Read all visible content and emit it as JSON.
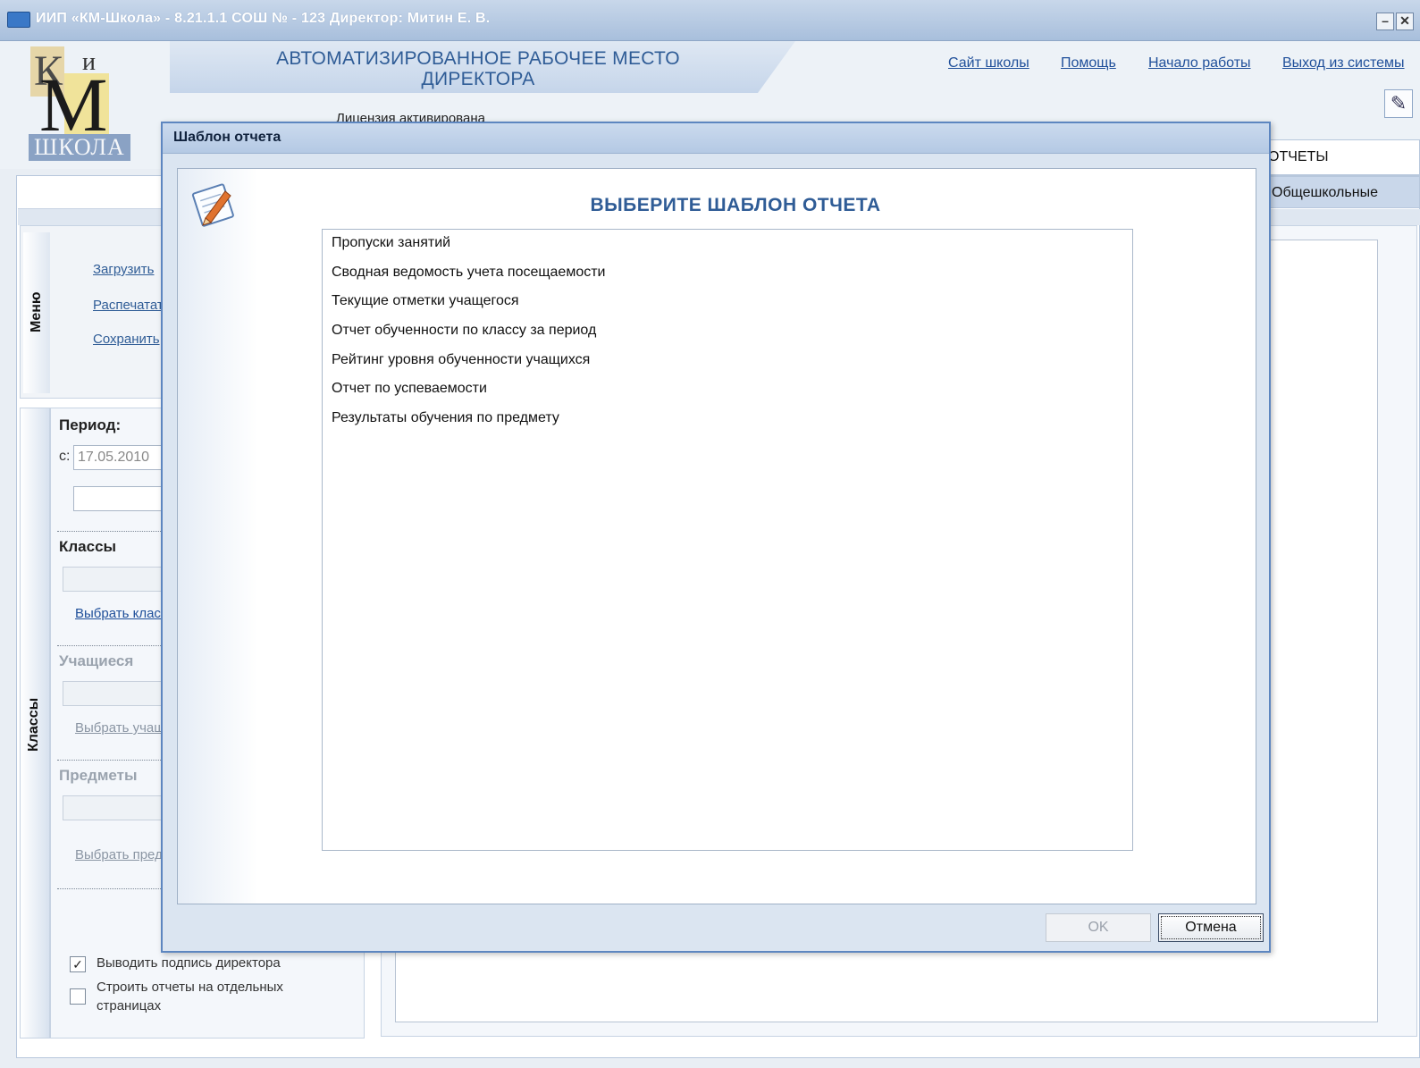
{
  "window": {
    "title": "ИИП «КМ-Школа» - 8.21.1.1 СОШ № - 123 Директор: Митин Е. В.",
    "minimize": "–",
    "close": "✕"
  },
  "logo": {
    "k": "К",
    "i": "и",
    "m": "М",
    "school": "ШКОЛА"
  },
  "header": {
    "banner": "АВТОМАТИЗИРОВАННОЕ РАБОЧЕЕ МЕСТО ДИРЕКТОРА",
    "license": "Лицензия активирована",
    "links": [
      "Сайт школы",
      "Помощь",
      "Начало работы",
      "Выход из системы"
    ],
    "edit_icon": "✎"
  },
  "tabs": {
    "reports": "ОТЧЕТЫ",
    "school_wide": "Общешкольные"
  },
  "menu": {
    "label": "Меню",
    "items": [
      "Загрузить",
      "Распечатать",
      "Сохранить"
    ]
  },
  "left": {
    "vertical_label": "Классы",
    "period_title": "Период:",
    "date_prefix": "с:",
    "date_from": "17.05.2010",
    "classes_title": "Классы",
    "classes_link": "Выбрать классы",
    "students_title": "Учащиеся",
    "students_link": "Выбрать учащихся",
    "subjects_title": "Предметы",
    "subjects_link": "Выбрать предметы",
    "chk1": {
      "checked": true,
      "label": "Выводить подпись директора",
      "mark": "✓"
    },
    "chk2": {
      "checked": false,
      "label": "Строить отчеты на отдельных страницах"
    }
  },
  "dialog": {
    "title": "Шаблон отчета",
    "heading": "ВЫБЕРИТЕ ШАБЛОН ОТЧЕТА",
    "templates": [
      "Пропуски занятий",
      "Сводная ведомость учета посещаемости",
      "Текущие отметки учащегося",
      "Отчет обученности по классу за период",
      "Рейтинг уровня обученности учащихся",
      "Отчет по успеваемости",
      "Результаты обучения по предмету"
    ],
    "ok": "OK",
    "cancel": "Отмена"
  },
  "colors": {
    "accent": "#2f5c96",
    "link": "#1f4f9a",
    "dialog_border": "#5d86c0"
  }
}
